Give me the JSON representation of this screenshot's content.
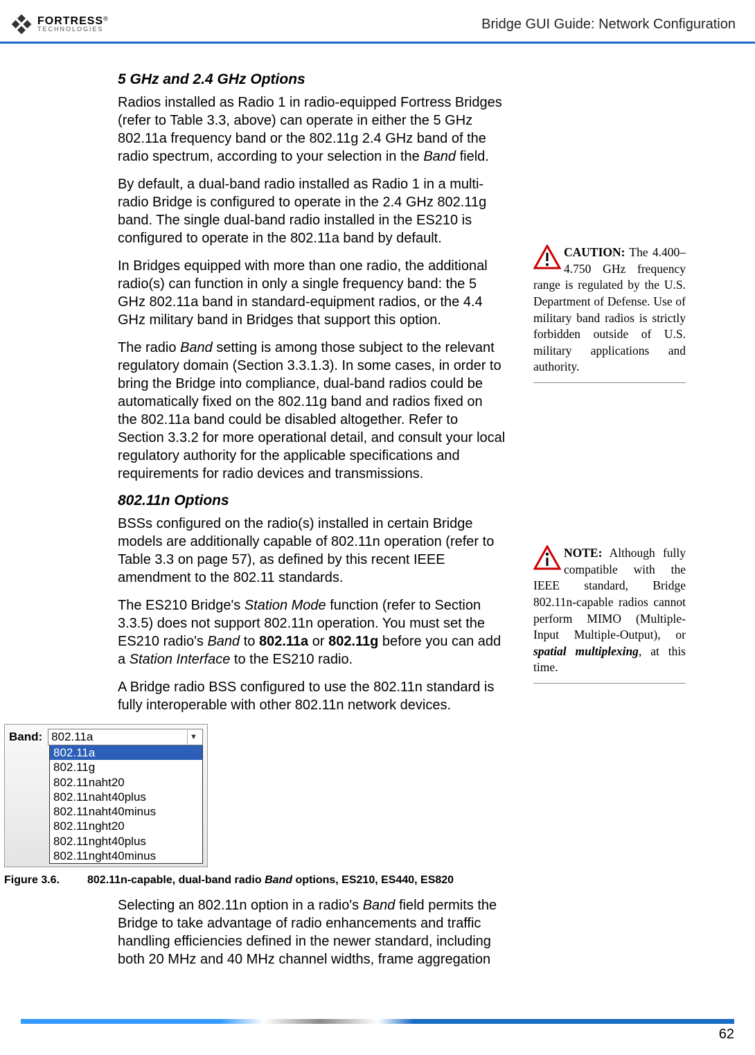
{
  "header": {
    "logo_line1": "FORTRESS",
    "logo_line2": "TECHNOLOGIES",
    "reg": "®",
    "right": "Bridge GUI Guide: Network Configuration"
  },
  "section1_heading": "5 GHz and 2.4 GHz Options",
  "p1": "Radios installed as Radio 1 in radio-equipped Fortress Bridges (refer to Table 3.3, above) can operate in either the 5 GHz 802.11a frequency band or the 802.11g 2.4 GHz band of the radio spectrum, according to your selection in the ",
  "p1_it": "Band",
  "p1_end": " field.",
  "p2": "By default, a dual-band radio installed as Radio 1 in a multi-radio Bridge is configured to operate in the 2.4 GHz 802.11g band. The single dual-band radio installed in the ES210 is configured to operate in the 802.11a band by default.",
  "p3": "In Bridges equipped with more than one radio, the additional radio(s) can function in only a single frequency band: the 5 GHz 802.11a band in standard-equipment radios, or the 4.4 GHz military band in Bridges that support this option.",
  "p4a": "The radio ",
  "p4_it": "Band",
  "p4b": " setting is among those subject to the relevant regulatory domain (Section 3.3.1.3). In some cases, in order to bring the Bridge into compliance, dual-band radios could be automatically fixed on the 802.11g band and radios fixed on the 802.11a band could be disabled altogether. Refer to Section 3.3.2 for more operational detail, and consult your local regulatory authority for the applicable specifications and requirements for radio devices and transmissions.",
  "section2_heading": "802.11n Options",
  "p5": "BSSs configured on the radio(s) installed in certain Bridge models are additionally capable of 802.11n operation (refer to Table 3.3 on page 57), as defined by this recent IEEE amendment to the 802.11 standards.",
  "p6a": "The ES210 Bridge's ",
  "p6_it1": "Station Mode",
  "p6b": " function (refer to Section 3.3.5) does not support 802.11n operation. You must set the ES210 radio's ",
  "p6_it2": "Band",
  "p6c": " to ",
  "p6_b1": "802.11a",
  "p6d": " or ",
  "p6_b2": "802.11g",
  "p6e": " before you can add a ",
  "p6_it3": "Station Interface",
  "p6f": " to the ES210 radio.",
  "p7": "A Bridge radio BSS configured to use the 802.11n standard is fully interoperable with other 802.11n network devices.",
  "caution_label": "CAUTION:",
  "caution_body": " The 4.400–4.750 GHz frequency range is regulated by the U.S. Department of Defense. Use of military band radios is strictly forbidden outside of U.S. military applications and authority.",
  "note_label": "NOTE:",
  "note_a": " Although fully compatible with the IEEE standard, Bridge 802.11n-capable radios cannot perform MIMO (Multiple-Input Multiple-Output), or ",
  "note_em": "spatial multiplexing",
  "note_b": ", at this time.",
  "combo": {
    "label": "Band:",
    "selected": "802.11a",
    "options": [
      "802.11a",
      "802.11g",
      "802.11naht20",
      "802.11naht40plus",
      "802.11naht40minus",
      "802.11nght20",
      "802.11nght40plus",
      "802.11nght40minus"
    ]
  },
  "figure_label": "Figure 3.6.",
  "figure_text_a": "802.11n-capable, dual-band radio ",
  "figure_text_it": "Band",
  "figure_text_b": " options, ES210, ES440, ES820",
  "p8a": "Selecting an 802.11n option in a radio's ",
  "p8_it": "Band",
  "p8b": " field permits the Bridge to take advantage of radio enhancements and traffic handling efficiencies defined in the newer standard, including both 20 MHz and 40 MHz channel widths, frame aggregation",
  "page_number": "62"
}
